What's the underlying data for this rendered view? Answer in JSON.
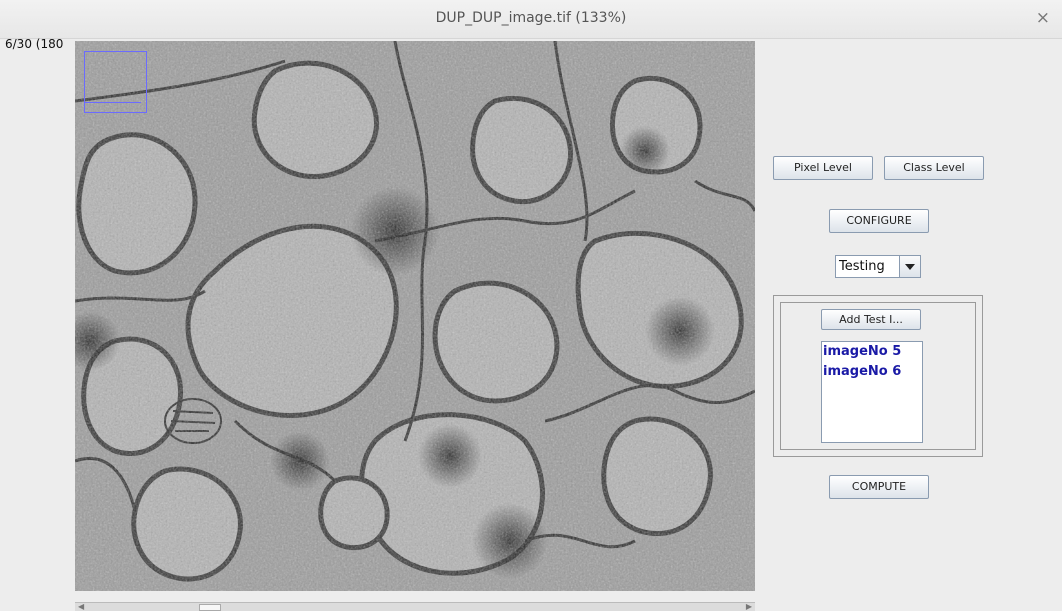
{
  "window": {
    "title": "DUP_DUP_image.tif (133%)",
    "close_glyph": "×"
  },
  "viewer": {
    "slice_info": "6/30 (180",
    "image_description": "grayscale electron microscopy image of cells",
    "scroll_left": "◀",
    "scroll_right": "▶"
  },
  "controls": {
    "pixel_level": "Pixel Level",
    "class_level": "Class Level",
    "configure": "CONFIGURE",
    "mode_selected": "Testing",
    "add_test": "Add Test I...",
    "test_images": [
      "imageNo 5",
      "imageNo 6"
    ],
    "compute": "COMPUTE"
  },
  "colors": {
    "roi": "#6b6bff",
    "list_text": "#1a1aa6",
    "button_border": "#8a9bb0"
  }
}
